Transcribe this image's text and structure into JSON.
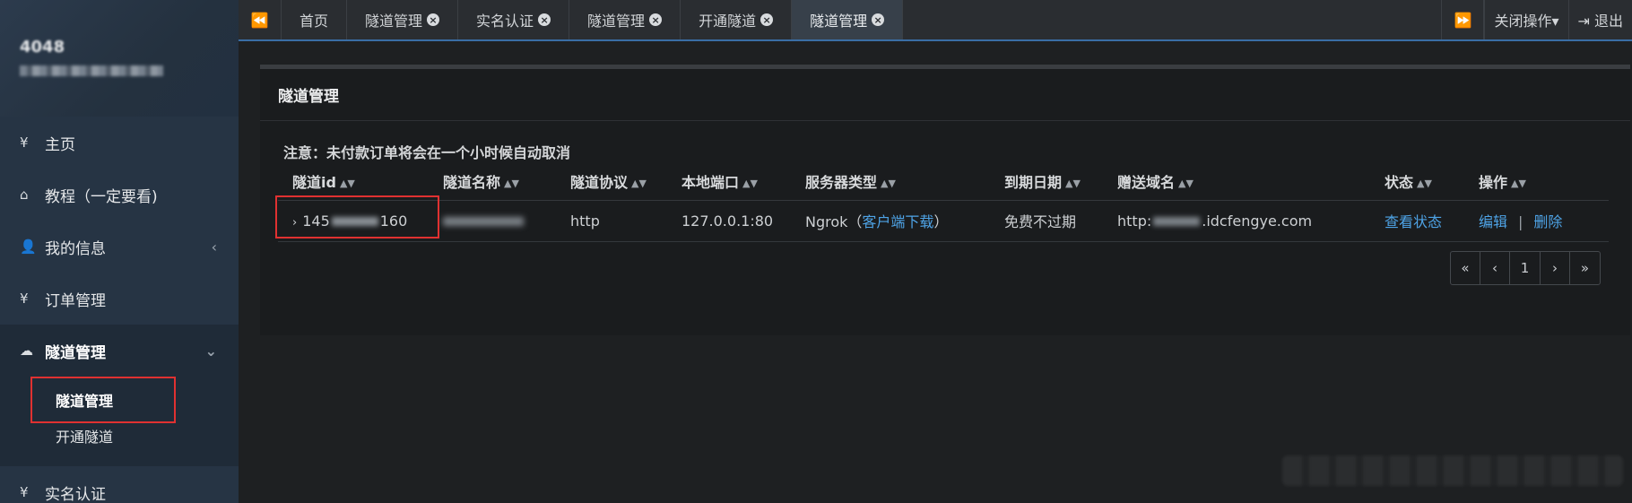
{
  "sidebar": {
    "user": {
      "name": "4048"
    },
    "items": [
      {
        "icon": "yen-icon",
        "glyph": "¥",
        "label": "主页"
      },
      {
        "icon": "home-icon",
        "glyph": "⌂",
        "label": "教程（一定要看)"
      },
      {
        "icon": "user-icon",
        "glyph": "👤",
        "label": "我的信息",
        "caret": "‹"
      },
      {
        "icon": "yen-icon",
        "glyph": "¥",
        "label": "订单管理"
      }
    ],
    "group": {
      "icon": "cloud-icon",
      "glyph": "☁",
      "label": "隧道管理",
      "caret": "⌄",
      "children": [
        {
          "label": "隧道管理",
          "active": true
        },
        {
          "label": "开通隧道",
          "active": false
        }
      ]
    },
    "bottom_item": {
      "icon": "yen-icon",
      "glyph": "¥",
      "label": "实名认证"
    }
  },
  "topbar": {
    "prev_icon": "⏪",
    "next_icon": "⏩",
    "tabs": [
      {
        "label": "首页",
        "closable": false,
        "active": false
      },
      {
        "label": "隧道管理",
        "closable": true,
        "active": false
      },
      {
        "label": "实名认证",
        "closable": true,
        "active": false
      },
      {
        "label": "隧道管理",
        "closable": true,
        "active": false
      },
      {
        "label": "开通隧道",
        "closable": true,
        "active": false
      },
      {
        "label": "隧道管理",
        "closable": true,
        "active": true
      }
    ],
    "close_ops": "关闭操作▾",
    "logout": "⇥ 退出"
  },
  "panel": {
    "title": "隧道管理",
    "notice": "注意：未付款订单将会在一个小时候自动取消",
    "columns": [
      "隧道id",
      "隧道名称",
      "隧道协议",
      "本地端口",
      "服务器类型",
      "到期日期",
      "赠送域名",
      "状态",
      "操作"
    ],
    "rows": [
      {
        "id_prefix": "145",
        "id_suffix": "160",
        "protocol": "http",
        "local_port": "127.0.0.1:80",
        "server_type": "Ngrok",
        "client_download": "客户端下载",
        "expiry": "免费不过期",
        "domain_prefix": "http:",
        "domain_suffix": ".idcfengye.com",
        "status_link": "查看状态",
        "edit": "编辑",
        "delete": "删除"
      }
    ],
    "pagination": {
      "first": "«",
      "prev": "‹",
      "current": "1",
      "next": "›",
      "last": "»"
    }
  },
  "colors": {
    "sidebar_bg": "#263444",
    "accent_link": "#4ea3e6",
    "highlight_box": "#e03131"
  }
}
